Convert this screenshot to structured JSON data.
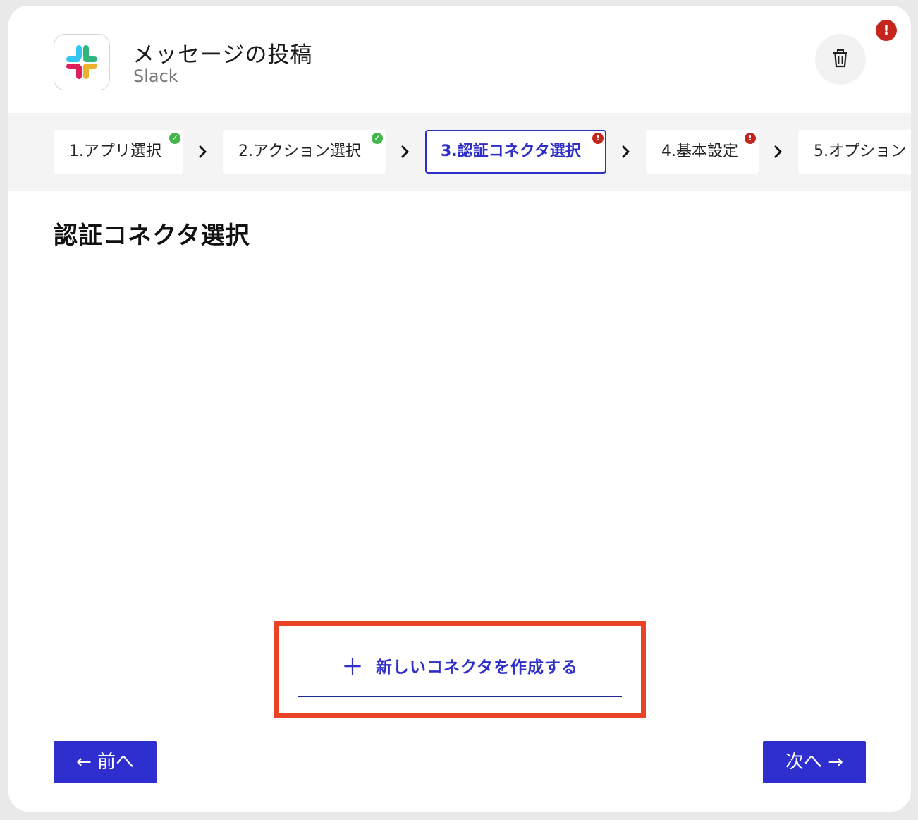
{
  "header": {
    "title": "メッセージの投稿",
    "app_name": "Slack",
    "alert_mark": "!"
  },
  "icons": {
    "app_logo": "slack-logo",
    "delete": "trash-icon",
    "alert": "exclamation-icon",
    "step_complete": "check-icon",
    "step_error": "exclamation-icon",
    "step_separator": "chevron-right-icon"
  },
  "steps": [
    {
      "label": "1.アプリ選択",
      "status": "complete"
    },
    {
      "label": "2.アクション選択",
      "status": "complete"
    },
    {
      "label": "3.認証コネクタ選択",
      "status": "error",
      "active": true
    },
    {
      "label": "4.基本設定",
      "status": "error"
    },
    {
      "label": "5.オプション",
      "status": "none"
    }
  ],
  "badges": {
    "check": "✓",
    "error": "!"
  },
  "section": {
    "title": "認証コネクタ選択"
  },
  "create_button": {
    "plus": "＋",
    "label": "新しいコネクタを作成する"
  },
  "nav": {
    "prev_label": "← 前へ",
    "next_label": "次へ →"
  },
  "colors": {
    "primary": "#2f2fcf",
    "error": "#c4261d",
    "success": "#43b649",
    "highlight": "#ea4426"
  }
}
